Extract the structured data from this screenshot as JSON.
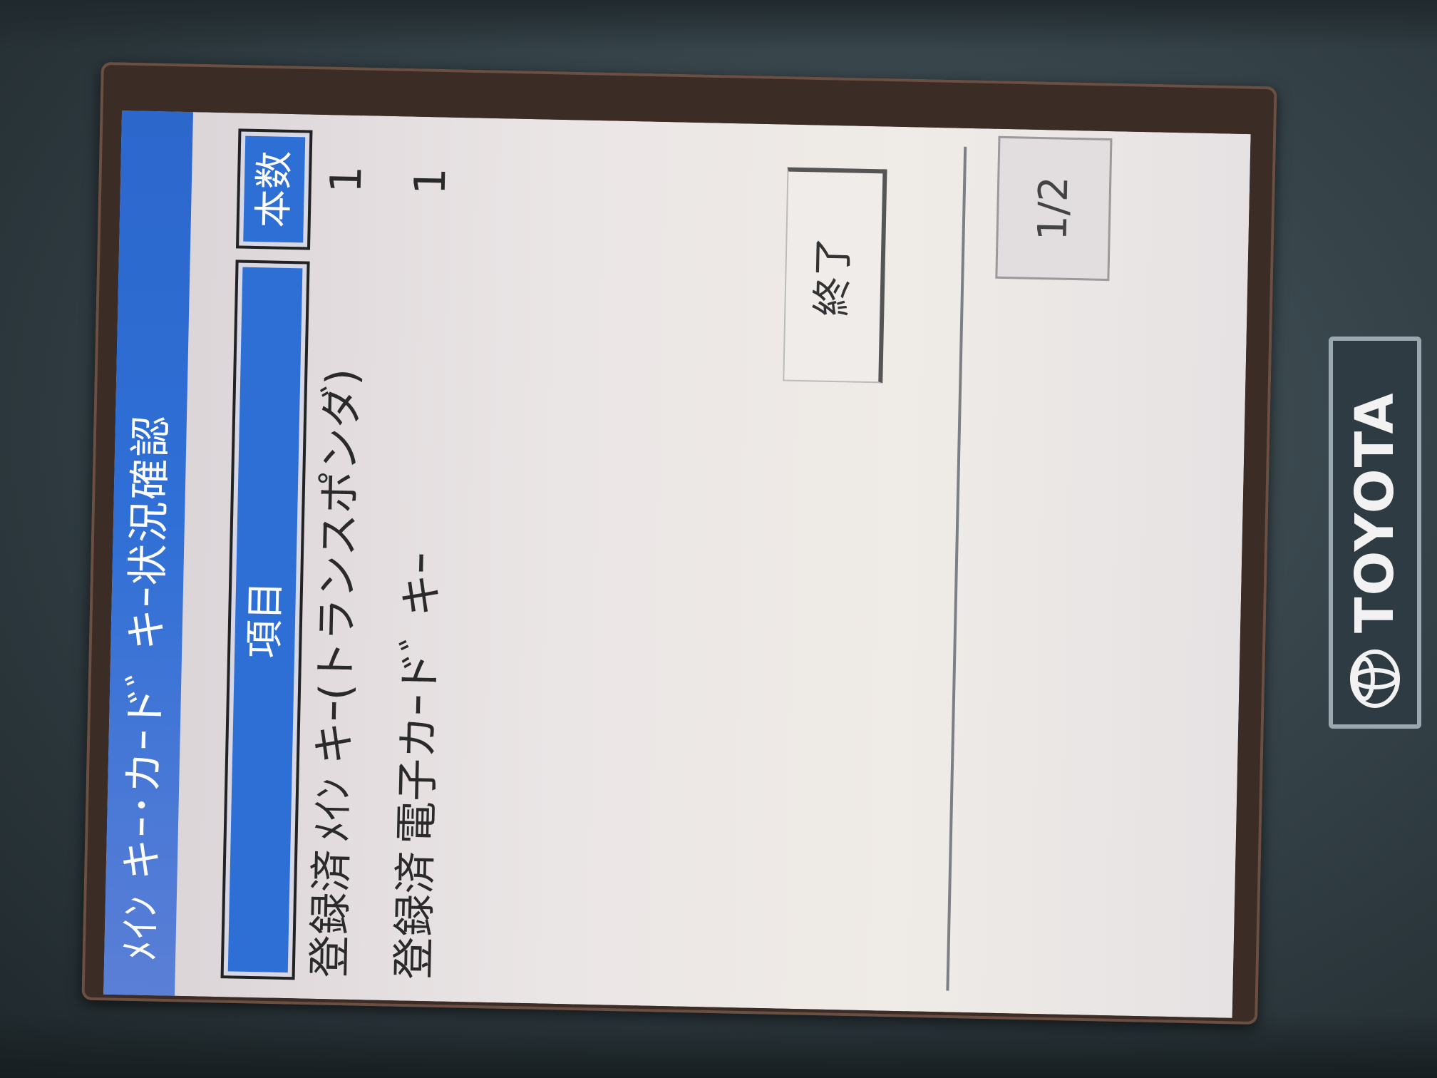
{
  "screen": {
    "title": "ﾒｲﾝ キｰ･カｰドﾞ キｰ状況確認",
    "columns": {
      "item": "項目",
      "count": "本数"
    },
    "rows": [
      {
        "status": "登録済",
        "name": "ﾒｲﾝ キｰ(トランスポンダ)",
        "count": "1"
      },
      {
        "status": "登録済",
        "name": "電子カｰドﾞ キｰ",
        "count": "1"
      }
    ],
    "end_button": "終了",
    "page": "1/2"
  },
  "device": {
    "brand": "TOYOTA"
  },
  "colors": {
    "title_bar": "#2f6fd6",
    "header_cell": "#2e6fd6",
    "screen_bg": "#ebe6e6",
    "housing": "#36444a"
  }
}
